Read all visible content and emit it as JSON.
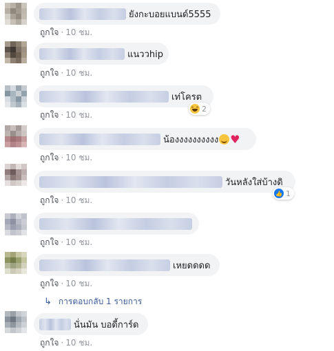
{
  "comments": [
    {
      "text": "ยังกะบอยแบนด์5555",
      "like_label": "ถูกใจ",
      "time": "10 ชม."
    },
    {
      "text": "แนววhip",
      "like_label": "ถูกใจ",
      "time": "10 ชม."
    },
    {
      "text": "เท่โครต",
      "like_label": "ถูกใจ",
      "time": "10 ชม.",
      "reaction": {
        "icon": "haha-icon",
        "count": "2"
      }
    },
    {
      "text": "น้องงงงงงงงงง",
      "like_label": "ถูกใจ",
      "time": "10 ชม.",
      "emojis": [
        "grinning-face-icon",
        "heart-icon"
      ]
    },
    {
      "text": "วันหลังใส่บ้างดิ",
      "like_label": "ถูกใจ",
      "time": "10 ชม.",
      "reaction": {
        "icon": "like-icon",
        "count": "1"
      }
    },
    {
      "text": "",
      "like_label": "ถูกใจ",
      "time": "10 ชม."
    },
    {
      "text": "เหยดดดด",
      "like_label": "ถูกใจ",
      "time": "10 ชม."
    },
    {
      "text": "นั่นมัน บอดี้การ์ด",
      "like_label": "ถูกใจ",
      "time": "10 ชม."
    }
  ],
  "replies_link": "การตอบกลับ 1 รายการ",
  "colors": {
    "bubble": "#f2f3f5",
    "meta": "#90949c",
    "link": "#385898",
    "like_blue": "#1877f2"
  }
}
